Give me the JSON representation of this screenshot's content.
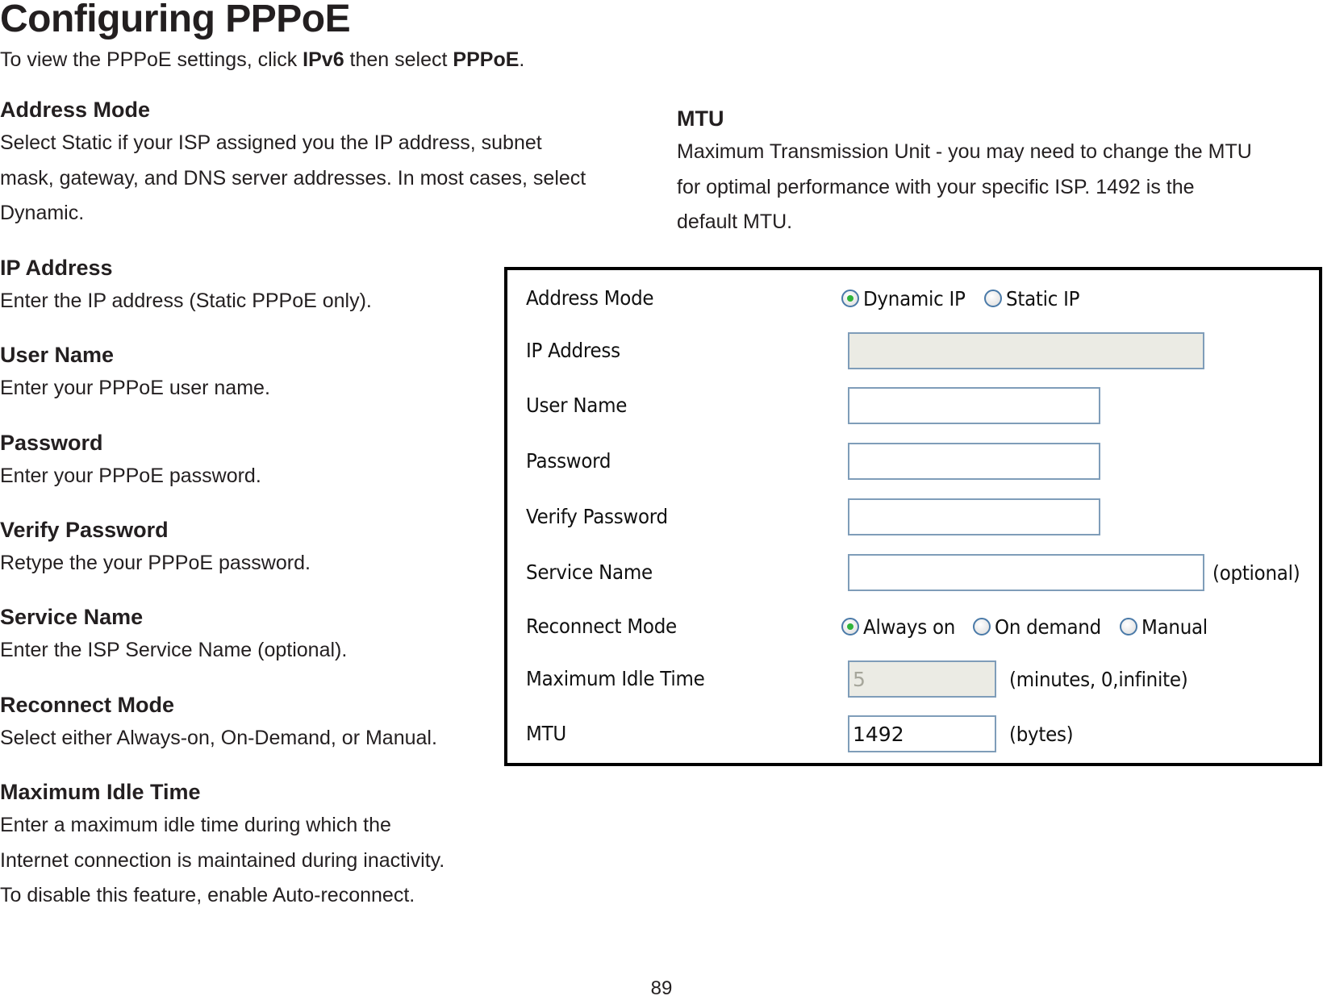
{
  "title": "Configuring PPPoE",
  "intro": {
    "prefix": "To view the PPPoE settings, click ",
    "bold1": "IPv6",
    "middle": " then select ",
    "bold2": "PPPoE",
    "suffix": "."
  },
  "sections": [
    {
      "heading": "Address Mode",
      "lines": [
        "Select Static if your ISP assigned you the IP address, subnet",
        "mask, gateway, and DNS server addresses. In most cases, select",
        "Dynamic."
      ]
    },
    {
      "heading": "IP Address",
      "lines": [
        "Enter the IP address (Static PPPoE only)."
      ]
    },
    {
      "heading": "User Name",
      "lines": [
        "Enter your PPPoE user name."
      ]
    },
    {
      "heading": "Password",
      "lines": [
        "Enter your PPPoE password."
      ]
    },
    {
      "heading": "Verify Password",
      "lines": [
        "Retype the your PPPoE password."
      ]
    },
    {
      "heading": "Service Name",
      "lines": [
        "Enter the ISP Service Name (optional)."
      ]
    },
    {
      "heading": "Reconnect Mode",
      "lines": [
        "Select either Always-on, On-Demand, or Manual."
      ]
    },
    {
      "heading": "Maximum Idle Time",
      "lines": [
        "Enter a maximum idle time during which the",
        "Internet connection is maintained during inactivity.",
        "To disable this feature, enable Auto-reconnect."
      ]
    },
    {
      "heading": "MTU",
      "lines": [
        "Maximum Transmission Unit - you may need to change the MTU",
        "for optimal performance with your specific ISP. 1492 is the",
        "default MTU."
      ]
    }
  ],
  "panel": {
    "address_mode": {
      "label": "Address Mode",
      "options": [
        {
          "label": "Dynamic IP",
          "checked": true
        },
        {
          "label": "Static IP",
          "checked": false
        }
      ]
    },
    "ip_address": {
      "label": "IP Address",
      "value": "",
      "disabled": true
    },
    "user_name": {
      "label": "User Name",
      "value": ""
    },
    "password": {
      "label": "Password",
      "value": ""
    },
    "verify_password": {
      "label": "Verify Password",
      "value": ""
    },
    "service_name": {
      "label": "Service Name",
      "value": "",
      "hint": "(optional)"
    },
    "reconnect_mode": {
      "label": "Reconnect Mode",
      "options": [
        {
          "label": "Always on",
          "checked": true
        },
        {
          "label": "On demand",
          "checked": false
        },
        {
          "label": "Manual",
          "checked": false
        }
      ]
    },
    "max_idle_time": {
      "label": "Maximum Idle Time",
      "value": "5",
      "disabled": true,
      "hint": "(minutes, 0,infinite)"
    },
    "mtu": {
      "label": "MTU",
      "value": "1492",
      "hint": "(bytes)"
    }
  },
  "page_number": "89",
  "colors": {
    "radio_checked": "#2fb43a",
    "input_border": "#7f9db9",
    "disabled_bg": "#ebebe4"
  }
}
